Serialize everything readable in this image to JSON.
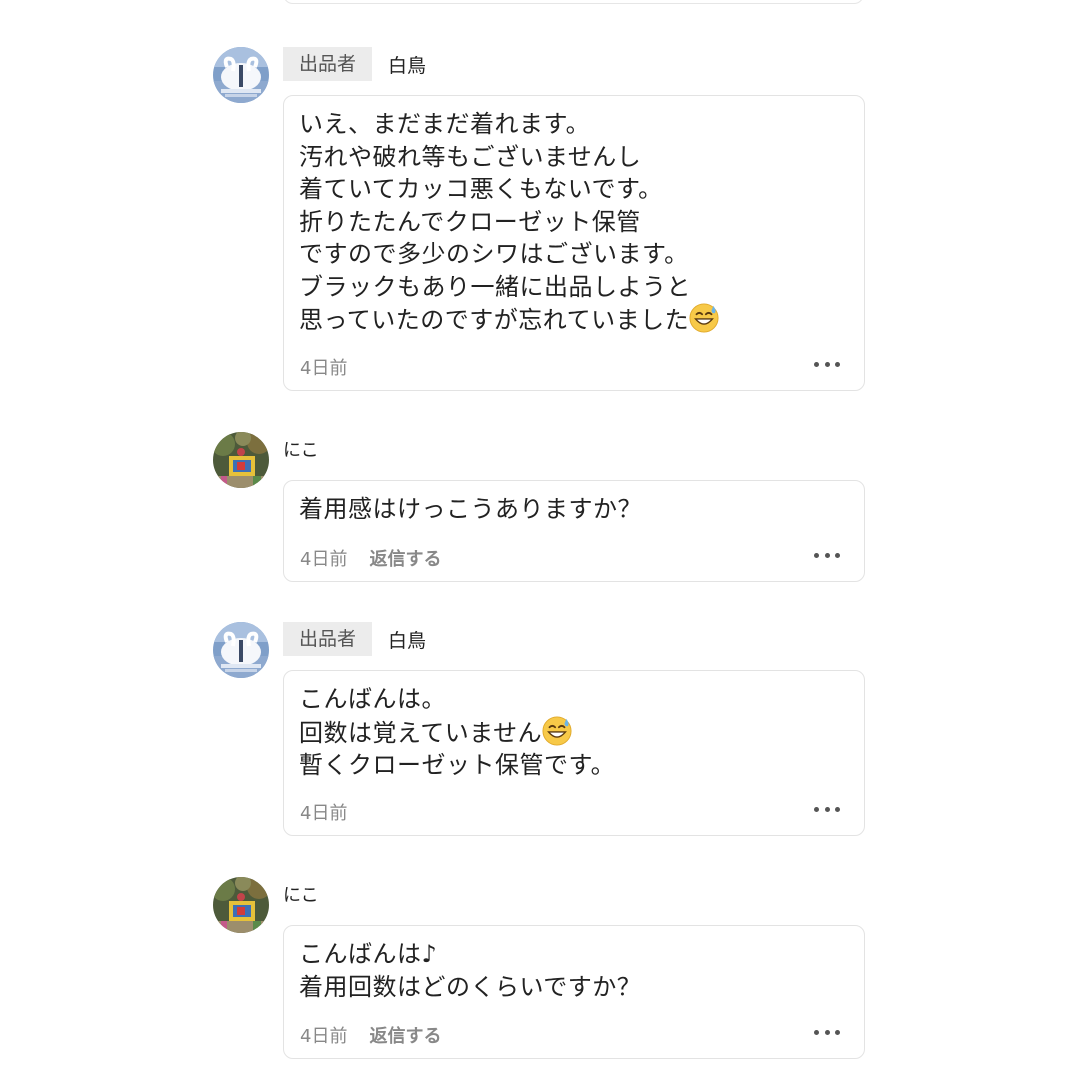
{
  "comments": [
    {
      "role": "seller",
      "badge": "出品者",
      "username": "白鳥",
      "avatar": "swan-avatar",
      "text": "いえ、まだまだ着れます。\n汚れや破れ等もございませんし\n着ていてカッコ悪くもないです。\n折りたたんでクローゼット保管\nですので多少のシワはございます。\nブラックもあり一緒に出品しようと\n思っていたのですが忘れていました",
      "emoji": "grinning-sweat-emoji",
      "time": "4日前",
      "reply_label": ""
    },
    {
      "role": "buyer",
      "badge": "",
      "username": "にこ",
      "avatar": "parade-avatar",
      "text": "着用感はけっこうありますか？",
      "emoji": "",
      "time": "4日前",
      "reply_label": "返信する"
    },
    {
      "role": "seller",
      "badge": "出品者",
      "username": "白鳥",
      "avatar": "swan-avatar",
      "text_parts": [
        "こんばんは。\n回数は覚えていません",
        "\n暫くクローゼット保管です。"
      ],
      "emoji": "grinning-sweat-emoji",
      "time": "4日前",
      "reply_label": ""
    },
    {
      "role": "buyer",
      "badge": "",
      "username": "にこ",
      "avatar": "parade-avatar",
      "text": "こんばんは♪\n着用回数はどのくらいですか？",
      "emoji": "",
      "time": "4日前",
      "reply_label": "返信する"
    }
  ],
  "more_icon": "more-dots-icon",
  "colors": {
    "badge_bg": "#ececec",
    "border": "#e3e3e3",
    "meta_text": "#888888"
  }
}
